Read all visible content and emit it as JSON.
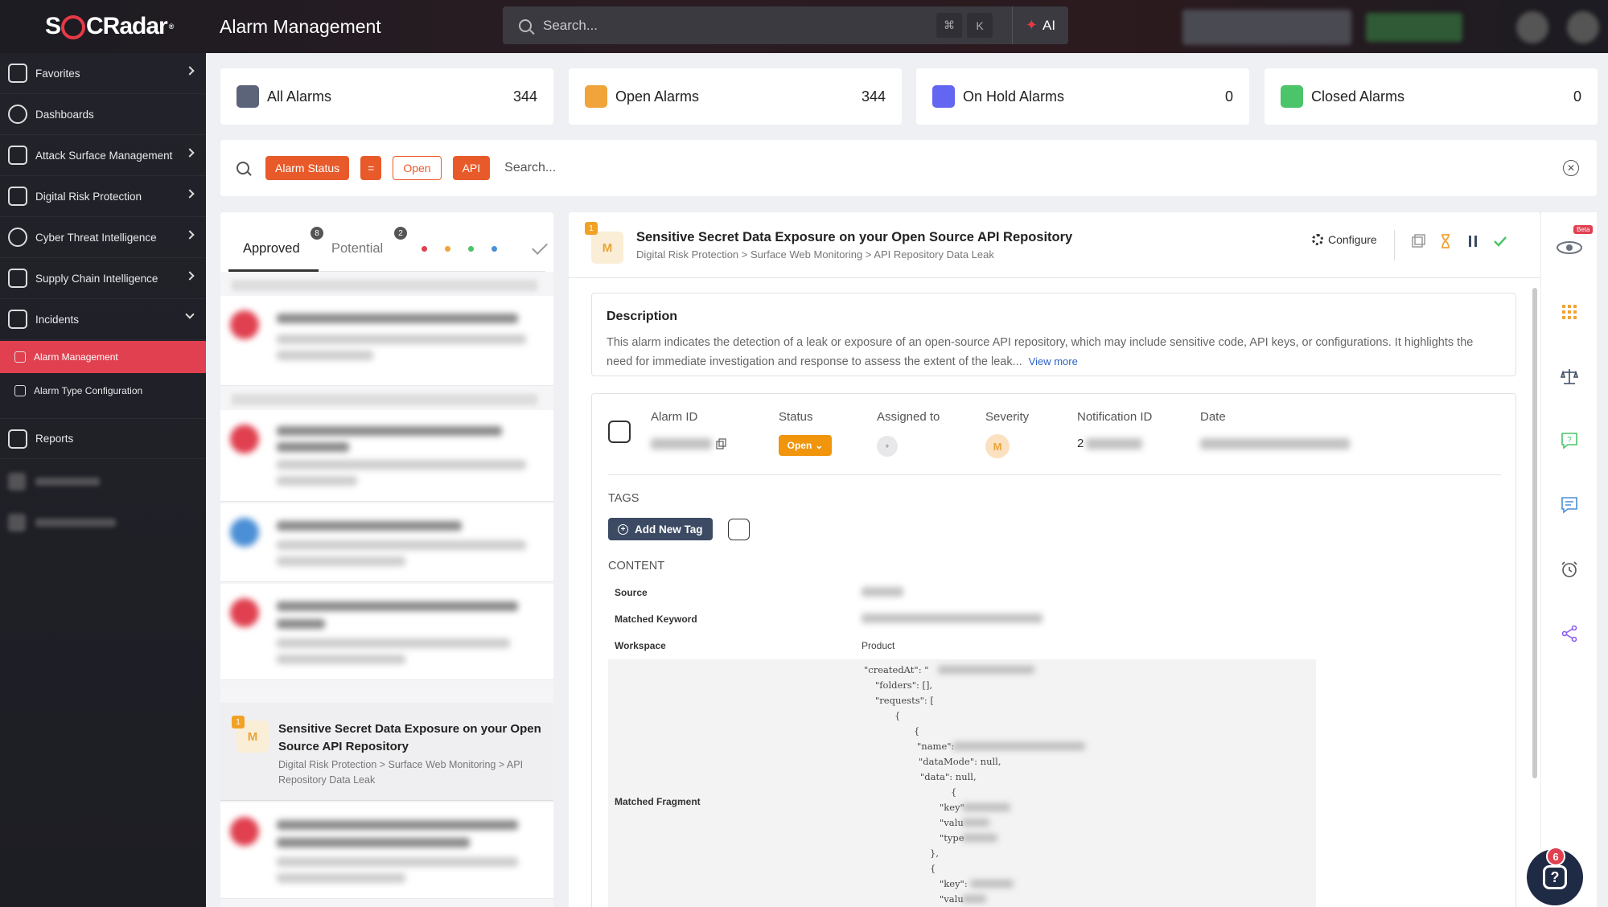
{
  "app": {
    "logo": "SOCRadar",
    "page_title": "Alarm Management"
  },
  "search": {
    "placeholder": "Search...",
    "shortcut_cmd": "⌘",
    "shortcut_key": "K",
    "ai_label": "AI"
  },
  "sidebar": {
    "items": [
      {
        "label": "Favorites",
        "icon": "bookmark-icon"
      },
      {
        "label": "Dashboards",
        "icon": "dashboard-icon"
      },
      {
        "label": "Attack Surface Management",
        "icon": "shield-icon"
      },
      {
        "label": "Digital Risk Protection",
        "icon": "hand-icon"
      },
      {
        "label": "Cyber Threat Intelligence",
        "icon": "eye-icon"
      },
      {
        "label": "Supply Chain Intelligence",
        "icon": "factory-icon"
      },
      {
        "label": "Incidents",
        "icon": "alert-icon"
      },
      {
        "label": "Reports",
        "icon": "report-icon"
      }
    ],
    "sub_items": [
      {
        "label": "Alarm Management"
      },
      {
        "label": "Alarm Type Configuration"
      }
    ]
  },
  "stats": [
    {
      "label": "All Alarms",
      "count": "344",
      "color": "#5b6478"
    },
    {
      "label": "Open Alarms",
      "count": "344",
      "color": "#f0a43a"
    },
    {
      "label": "On Hold Alarms",
      "count": "0",
      "color": "#6366f1"
    },
    {
      "label": "Closed Alarms",
      "count": "0",
      "color": "#4cc46a"
    }
  ],
  "filter": {
    "chips": [
      "Alarm Status",
      "=",
      "Open",
      "API"
    ],
    "placeholder": "Search..."
  },
  "list": {
    "tabs": [
      {
        "label": "Approved",
        "badge": "8"
      },
      {
        "label": "Potential",
        "badge": "2"
      }
    ],
    "dot_colors": [
      "#e0404f",
      "#f0a43a",
      "#4cc46a",
      "#4b8fd6"
    ],
    "selected": {
      "badge_letter": "M",
      "badge_count": "1",
      "title": "Sensitive Secret Data Exposure on your Open Source API Repository",
      "path": "Digital Risk Protection > Surface Web Monitoring > API Repository Data Leak"
    }
  },
  "detail": {
    "badge_letter": "M",
    "badge_count": "1",
    "title": "Sensitive Secret Data Exposure on your Open Source API Repository",
    "path": "Digital Risk Protection > Surface Web Monitoring > API Repository Data Leak",
    "configure_label": "Configure",
    "description_title": "Description",
    "description": "This alarm indicates the detection of a leak or exposure of an open-source API repository, which may include sensitive code, API keys, or configurations. It highlights the need for immediate investigation and response to assess the extent of the leak...",
    "view_more": "View more",
    "fields": {
      "alarm_id_label": "Alarm ID",
      "status_label": "Status",
      "status_value": "Open",
      "assigned_label": "Assigned to",
      "severity_label": "Severity",
      "severity_value": "M",
      "notification_label": "Notification ID",
      "notification_prefix": "2",
      "date_label": "Date"
    },
    "tags_label": "TAGS",
    "add_tag_label": "Add New Tag",
    "content_label": "CONTENT",
    "content_rows": {
      "source": "Source",
      "matched_keyword": "Matched Keyword",
      "workspace": "Workspace",
      "workspace_value": "Product",
      "matched_fragment": "Matched Fragment"
    },
    "json_lines": [
      "\"createdAt\": \"",
      "\"folders\": [],",
      "\"requests\": [",
      "{",
      "{",
      "\"name\":",
      "\"dataMode\": null,",
      "\"data\": null,",
      "{",
      "\"key\"",
      "\"valu",
      "\"type",
      "},",
      "{",
      "\"key\":",
      "\"valu"
    ]
  },
  "rail": {
    "beta_label": "Beta"
  },
  "help": {
    "badge": "6"
  }
}
